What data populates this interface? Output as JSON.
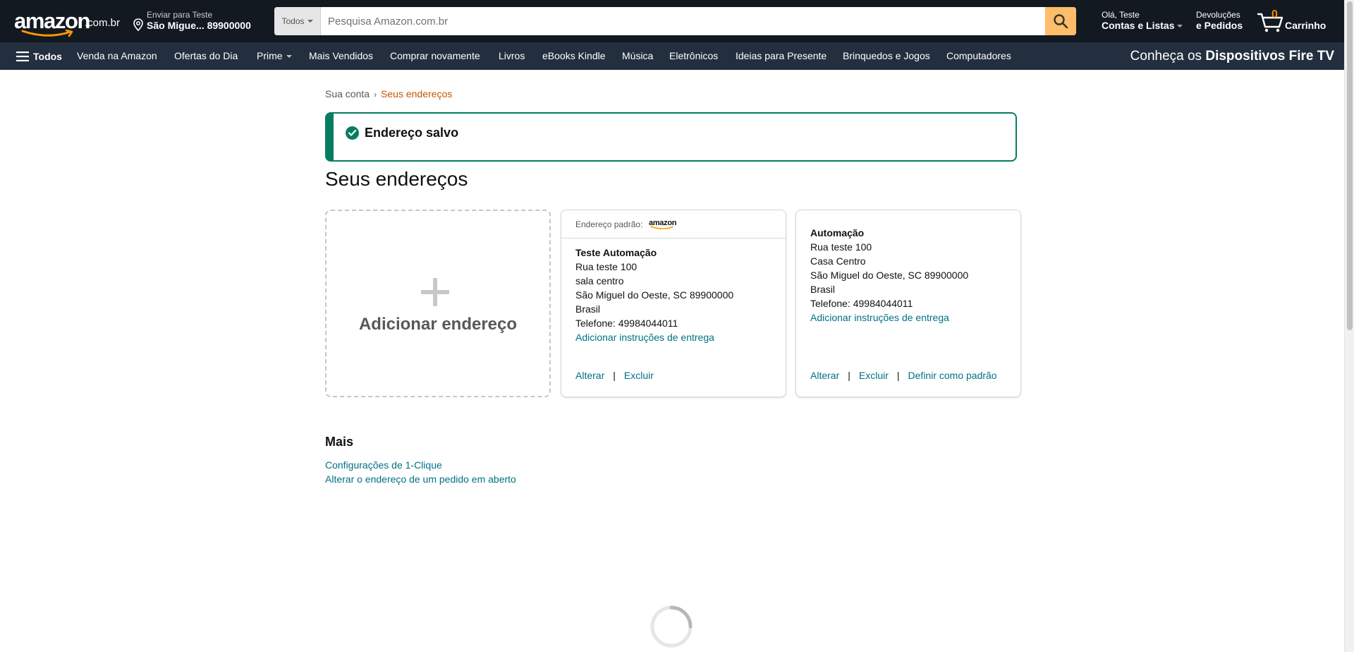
{
  "header": {
    "logo_text": "amazon",
    "logo_tld": ".com.br",
    "deliver_line1": "Enviar para Teste",
    "deliver_line2": "São Migue... 89900000",
    "search_category": "Todos",
    "search_placeholder": "Pesquisa Amazon.com.br",
    "account_line1": "Olá, Teste",
    "account_line2": "Contas e Listas",
    "returns_line1": "Devoluções",
    "returns_line2": "e Pedidos",
    "cart_count": "0",
    "cart_label": "Carrinho"
  },
  "nav": {
    "all_label": "Todos",
    "items": [
      "Venda na Amazon",
      "Ofertas do Dia",
      "Prime",
      "Mais Vendidos",
      "Comprar novamente",
      "Livros",
      "eBooks Kindle",
      "Música",
      "Eletrônicos",
      "Ideias para Presente",
      "Brinquedos e Jogos",
      "Computadores"
    ],
    "promo_prefix": "Conheça os",
    "promo_bold": "Dispositivos Fire TV"
  },
  "breadcrumb": {
    "account": "Sua conta",
    "separator": "›",
    "current": "Seus endereços"
  },
  "alert": {
    "message": "Endereço salvo"
  },
  "page_title": "Seus endereços",
  "add_card": {
    "label": "Adicionar endereço"
  },
  "default_card": {
    "header_label": "Endereço padrão:",
    "header_logo": "amazon",
    "name": "Teste Automação",
    "line1": "Rua teste 100",
    "line2": "sala centro",
    "city": "São Miguel do Oeste, SC 89900000",
    "country": "Brasil",
    "phone": "Telefone: 49984044011",
    "instructions_link": "Adicionar instruções de entrega",
    "edit": "Alterar",
    "delete": "Excluir",
    "separator": "|"
  },
  "other_card": {
    "name": "Automação",
    "line1": "Rua teste 100",
    "line2": "Casa Centro",
    "city": "São Miguel do Oeste, SC 89900000",
    "country": "Brasil",
    "phone": "Telefone: 49984044011",
    "instructions_link": "Adicionar instruções de entrega",
    "edit": "Alterar",
    "delete": "Excluir",
    "set_default": "Definir como padrão",
    "separator": "|"
  },
  "more": {
    "title": "Mais",
    "links": [
      "Configurações de 1-Clique",
      "Alterar o endereço de um pedido em aberto"
    ]
  },
  "colors": {
    "nav_dark": "#131921",
    "nav_secondary": "#232f3e",
    "search_button": "#febd69",
    "cart_count": "#f08804",
    "link": "#007185",
    "breadcrumb_active": "#c45500",
    "success": "#067d62"
  },
  "icons": {
    "location": "location-pin-icon",
    "search": "magnifier-icon",
    "cart": "cart-icon",
    "menu": "hamburger-icon",
    "success": "check-circle-icon",
    "add": "plus-icon",
    "loading": "spinner-icon"
  }
}
